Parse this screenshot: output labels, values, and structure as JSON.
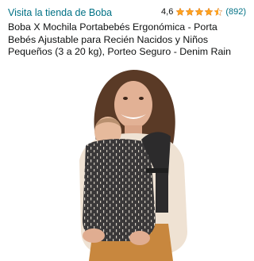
{
  "store": {
    "link_label": "Visita la tienda de Boba"
  },
  "rating": {
    "value": "4,6",
    "stars": 4.5,
    "count": "(892)"
  },
  "product": {
    "title": "Boba X Mochila Portabebés Ergonómica - Porta Bebés Ajustable para Recién Nacidos y Niños Pequeños (3 a 20 kg), Porteo Seguro - Denim Rain"
  },
  "colors": {
    "link": "#007185",
    "star": "#ffa41c",
    "text": "#0f1111"
  }
}
